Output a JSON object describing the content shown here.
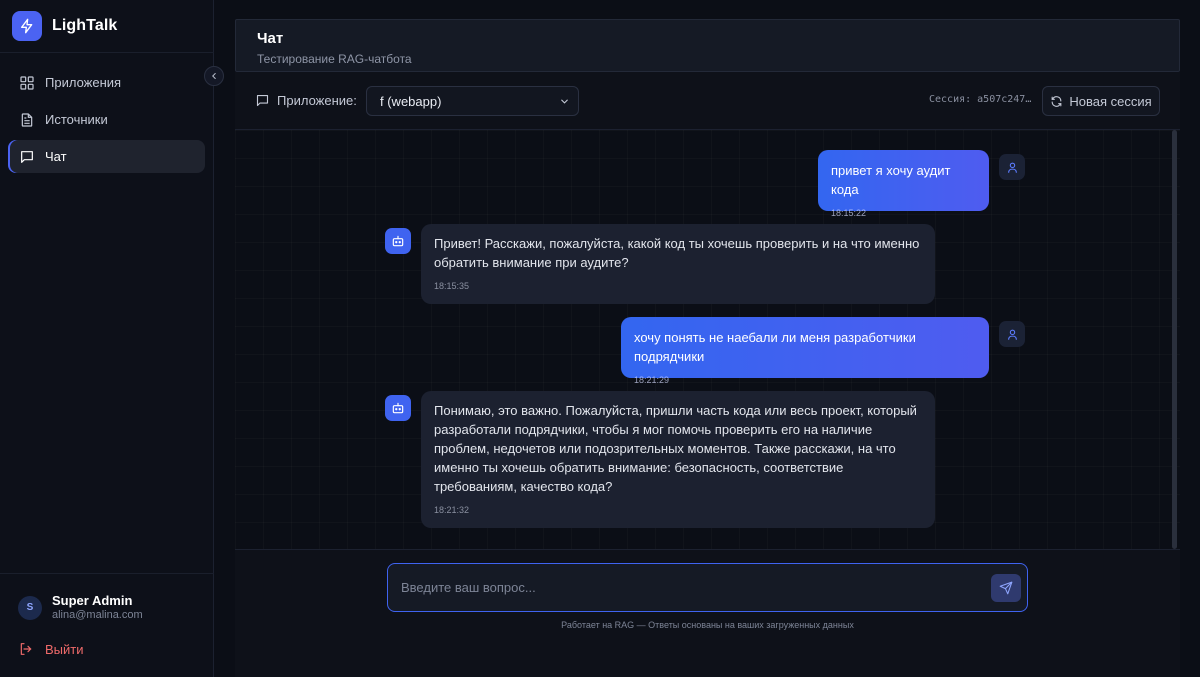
{
  "brand": {
    "name": "LighTalk",
    "icon": "lightning-icon",
    "accent": "#4b63f2"
  },
  "sidebar": {
    "items": [
      {
        "label": "Приложения",
        "icon": "grid-icon",
        "active": false
      },
      {
        "label": "Источники",
        "icon": "document-icon",
        "active": false
      },
      {
        "label": "Чат",
        "icon": "chat-icon",
        "active": true
      }
    ],
    "user": {
      "initial": "S",
      "name": "Super Admin",
      "email": "alina@malina.com"
    },
    "logout_label": "Выйти"
  },
  "header": {
    "title": "Чат",
    "subtitle": "Тестирование RAG-чатбота"
  },
  "toolbar": {
    "app_label": "Приложение:",
    "app_selected": "f (webapp)",
    "session_text": "Сессия: a507c247…",
    "new_session_label": "Новая сессия"
  },
  "messages": [
    {
      "role": "user",
      "text": "привет я хочу аудит кода",
      "time": "18:15:22"
    },
    {
      "role": "bot",
      "text": "Привет! Расскажи, пожалуйста, какой код ты хочешь проверить и на что именно обратить внимание при аудите?",
      "time": "18:15:35"
    },
    {
      "role": "user",
      "text": "хочу понять не наебали ли меня разработчики подрядчики",
      "time": "18:21:29"
    },
    {
      "role": "bot",
      "text": "Понимаю, это важно. Пожалуйста, пришли часть кода или весь проект, который разработали подрядчики, чтобы я мог помочь проверить его на наличие проблем, недочетов или подозрительных моментов. Также расскажи, на что именно ты хочешь обратить внимание: безопасность, соответствие требованиям, качество кода?",
      "time": "18:21:32"
    }
  ],
  "composer": {
    "placeholder": "Введите ваш вопрос...",
    "footer_note": "Работает на RAG — Ответы основаны на ваших загруженных данных"
  }
}
